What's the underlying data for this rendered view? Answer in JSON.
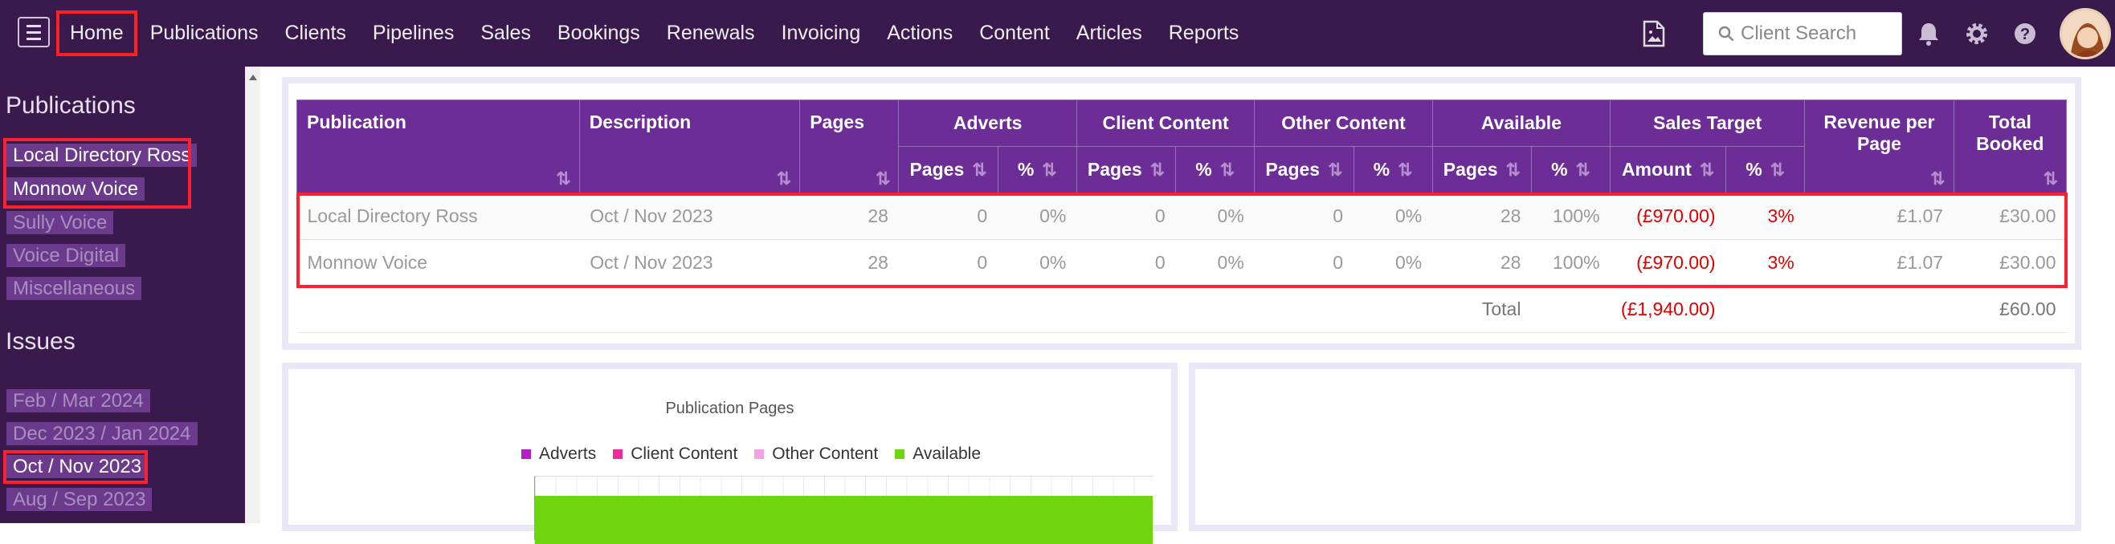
{
  "nav": {
    "items": [
      "Home",
      "Publications",
      "Clients",
      "Pipelines",
      "Sales",
      "Bookings",
      "Renewals",
      "Invoicing",
      "Actions",
      "Content",
      "Articles",
      "Reports"
    ],
    "search_placeholder": "Client Search"
  },
  "sidebar": {
    "publications_heading": "Publications",
    "publications": [
      "Local Directory Ross",
      "Monnow Voice",
      "Sully Voice",
      "Voice Digital",
      "Miscellaneous"
    ],
    "issues_heading": "Issues",
    "issues": [
      "Feb / Mar 2024",
      "Dec 2023 / Jan 2024",
      "Oct / Nov 2023",
      "Aug / Sep 2023"
    ]
  },
  "table": {
    "headers": {
      "publication": "Publication",
      "description": "Description",
      "pages": "Pages",
      "adverts": "Adverts",
      "client_content": "Client Content",
      "other_content": "Other Content",
      "available": "Available",
      "sales_target": "Sales Target",
      "revenue_per_page": "Revenue per Page",
      "total_booked": "Total Booked",
      "sub_pages": "Pages",
      "sub_pct": "%",
      "sub_amount": "Amount"
    },
    "rows": [
      [
        "Local Directory Ross",
        "Oct / Nov 2023",
        "28",
        "0",
        "0%",
        "0",
        "0%",
        "0",
        "0%",
        "28",
        "100%",
        "(£970.00)",
        "3%",
        "£1.07",
        "£30.00"
      ],
      [
        "Monnow Voice",
        "Oct / Nov 2023",
        "28",
        "0",
        "0%",
        "0",
        "0%",
        "0",
        "0%",
        "28",
        "100%",
        "(£970.00)",
        "3%",
        "£1.07",
        "£30.00"
      ]
    ],
    "total_label": "Total",
    "total_amount": "(£1,940.00)",
    "total_booked": "£60.00"
  },
  "chart": {
    "title": "Publication Pages",
    "legend": [
      {
        "name": "Adverts",
        "color": "#b21fc7"
      },
      {
        "name": "Client Content",
        "color": "#ee2b9a"
      },
      {
        "name": "Other Content",
        "color": "#f0a4e4"
      },
      {
        "name": "Available",
        "color": "#6fd60e"
      }
    ]
  }
}
